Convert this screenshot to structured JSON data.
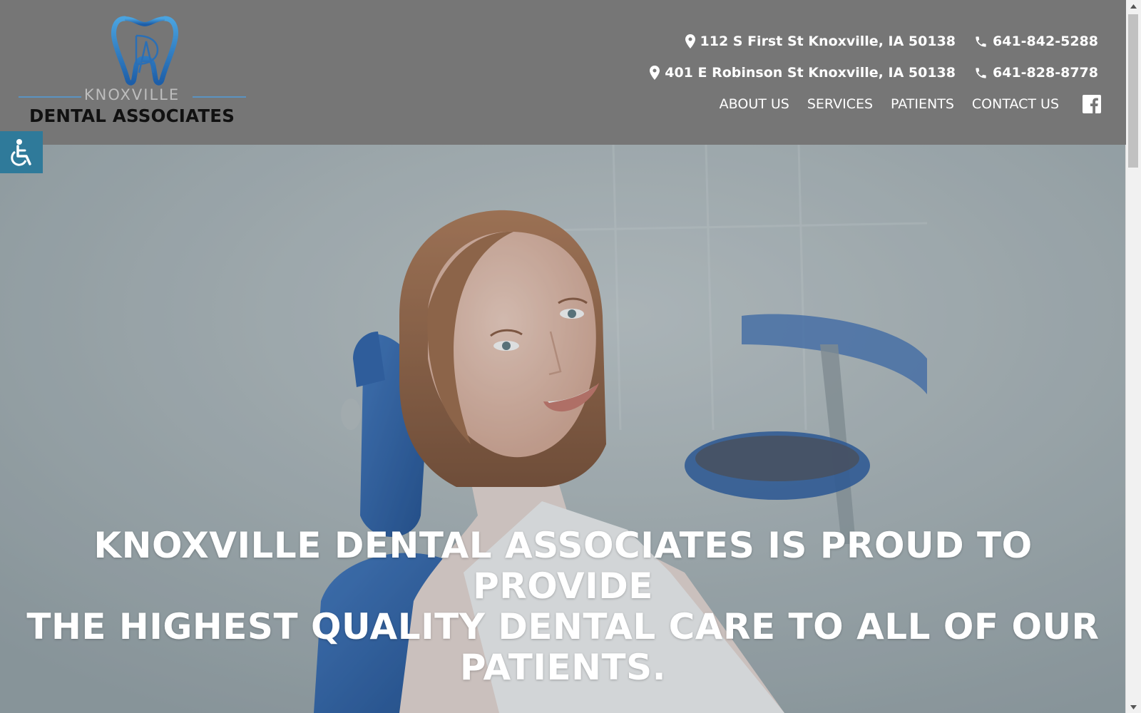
{
  "header": {
    "logo": {
      "line1": "KNOXVILLE",
      "line2": "DENTAL ASSOCIATES"
    },
    "locations": [
      {
        "address": "112 S First St Knoxville, IA 50138",
        "phone": "641-842-5288"
      },
      {
        "address": "401 E Robinson St Knoxville, IA 50138",
        "phone": "641-828-8778"
      }
    ],
    "nav": [
      "ABOUT US",
      "SERVICES",
      "PATIENTS",
      "CONTACT US"
    ],
    "social_icon": "facebook-icon"
  },
  "accessibility": {
    "icon": "wheelchair-icon"
  },
  "hero": {
    "title_lines": [
      "KNOXVILLE DENTAL ASSOCIATES IS PROUD TO PROVIDE",
      "THE HIGHEST QUALITY DENTAL CARE TO ALL OF OUR",
      "PATIENTS."
    ]
  },
  "colors": {
    "header_bg": "#767676",
    "accent_blue": "#2f7a9a",
    "logo_blue": "#3a7fc0",
    "text_light": "#ffffff"
  }
}
